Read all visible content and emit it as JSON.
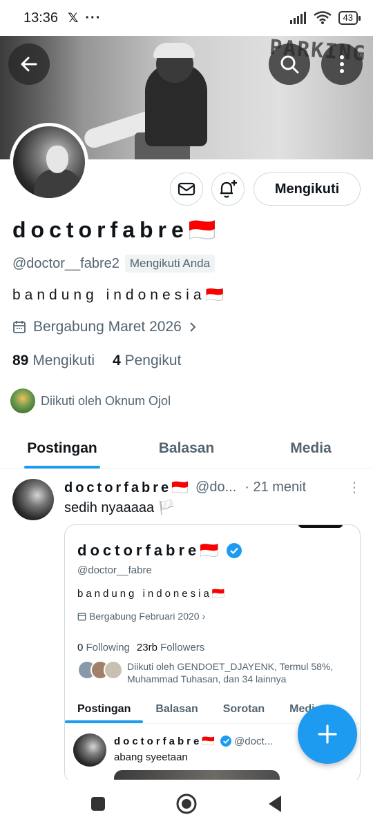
{
  "status_bar": {
    "time": "13:36",
    "app_glyph": "𝕏",
    "more": "···",
    "battery": "43"
  },
  "banner": {
    "graffiti": "PARKING"
  },
  "profile": {
    "display_name": "doctorfabre🇮🇩",
    "handle": "@doctor__fabre2",
    "follows_you": "Mengikuti Anda",
    "bio": "bandung  indonesia🇮🇩",
    "joined": "Bergabung Maret 2026",
    "following_count": "89",
    "following_label": "Mengikuti",
    "followers_count": "4",
    "followers_label": "Pengikut",
    "followed_by": "Diikuti oleh Oknum Ojol",
    "follow_button": "Mengikuti"
  },
  "tabs": [
    {
      "label": "Postingan",
      "active": true
    },
    {
      "label": "Balasan",
      "active": false
    },
    {
      "label": "Media",
      "active": false
    }
  ],
  "tweet": {
    "name": "doctorfabre🇮🇩",
    "handle": "@do...",
    "time": "· 21 menit",
    "text": "sedih nyaaaaa 🏳️",
    "card": {
      "name": "doctorfabre🇮🇩",
      "handle": "@doctor__fabre",
      "bio": "bandung  indonesia🇮🇩",
      "joined": "Bergabung Februari 2020",
      "following_count": "0",
      "following_label": "Following",
      "followers_count": "23rb",
      "followers_label": "Followers",
      "followed_by": "Diikuti oleh GENDOET_DJAYENK, Termul 58%, Muhammad Tuhasan, dan 34 lainnya",
      "tabs": [
        "Postingan",
        "Balasan",
        "Sorotan",
        "Media"
      ],
      "inner_tweet": {
        "name": "doctorfabre🇮🇩",
        "handle": "@doct...",
        "text": "abang syeetaan"
      }
    }
  },
  "colors": {
    "accent": "#1d9bf0",
    "text_primary": "#0f1419",
    "text_secondary": "#536471",
    "border": "#cfd9de"
  }
}
